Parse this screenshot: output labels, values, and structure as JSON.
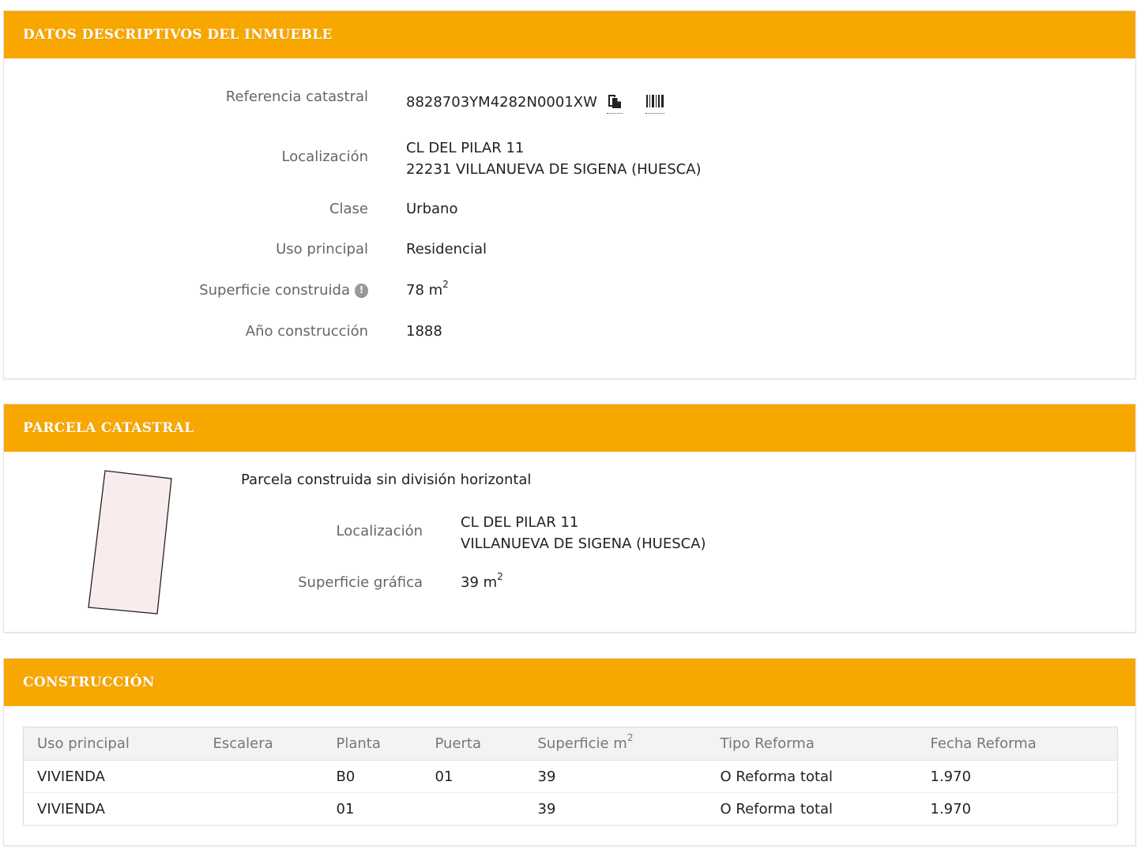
{
  "descriptivos": {
    "header": "DATOS DESCRIPTIVOS DEL INMUEBLE",
    "referencia_label": "Referencia catastral",
    "referencia_value": "8828703YM4282N0001XW",
    "localizacion_label": "Localización",
    "localizacion_line1": "CL DEL PILAR 11",
    "localizacion_line2": "22231 VILLANUEVA DE SIGENA (HUESCA)",
    "clase_label": "Clase",
    "clase_value": "Urbano",
    "uso_label": "Uso principal",
    "uso_value": "Residencial",
    "superficie_label": "Superficie construida",
    "superficie_value": "78 m",
    "superficie_unit_exp": "2",
    "anio_label": "Año construcción",
    "anio_value": "1888"
  },
  "parcela": {
    "header": "PARCELA CATASTRAL",
    "tipo": "Parcela construida sin división horizontal",
    "localizacion_label": "Localización",
    "localizacion_line1": "CL DEL PILAR 11",
    "localizacion_line2": "VILLANUEVA DE SIGENA (HUESCA)",
    "superficie_label": "Superficie gráfica",
    "superficie_value": "39 m",
    "superficie_unit_exp": "2"
  },
  "construccion": {
    "header": "CONSTRUCCIÓN",
    "columns": [
      "Uso principal",
      "Escalera",
      "Planta",
      "Puerta",
      "Superficie m",
      "Tipo Reforma",
      "Fecha Reforma"
    ],
    "superficie_col_exp": "2",
    "rows": [
      [
        "VIVIENDA",
        "",
        "B0",
        "01",
        "39",
        "O Reforma total",
        "1.970"
      ],
      [
        "VIVIENDA",
        "",
        "01",
        "",
        "39",
        "O Reforma total",
        "1.970"
      ]
    ]
  },
  "icons": {
    "info": "info-icon",
    "copy": "copy-icon",
    "barcode": "barcode-icon"
  },
  "colors": {
    "header_bg": "#f8a600",
    "parcel_fill": "#f9ecec"
  }
}
